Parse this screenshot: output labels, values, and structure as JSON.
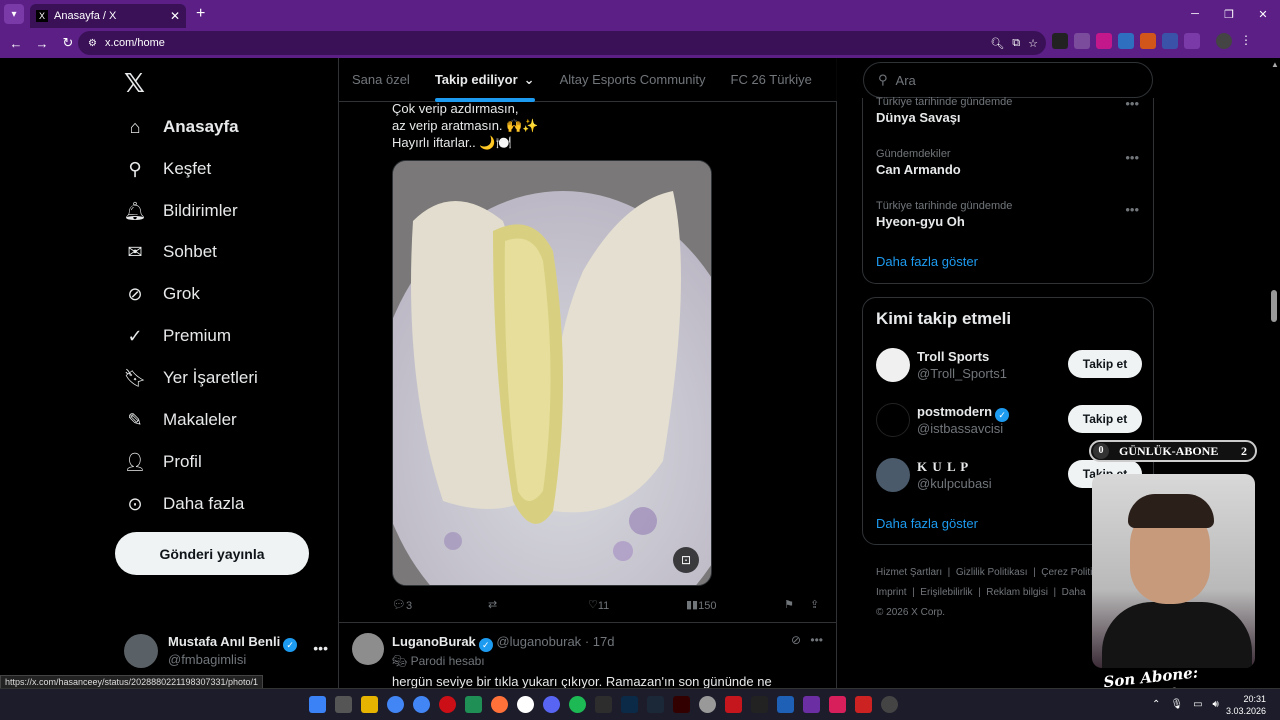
{
  "browser": {
    "tab_title": "Anasayfa / X",
    "url": "x.com/home",
    "status_link": "https://x.com/hasanceey/status/2028880221198307331/photo/1"
  },
  "sidebar": {
    "items": [
      {
        "label": "Anasayfa",
        "icon": "home-icon"
      },
      {
        "label": "Keşfet",
        "icon": "search-icon"
      },
      {
        "label": "Bildirimler",
        "icon": "bell-icon"
      },
      {
        "label": "Sohbet",
        "icon": "mail-icon"
      },
      {
        "label": "Grok",
        "icon": "grok-icon"
      },
      {
        "label": "Premium",
        "icon": "premium-icon"
      },
      {
        "label": "Yer İşaretleri",
        "icon": "bookmark-icon"
      },
      {
        "label": "Makaleler",
        "icon": "article-icon"
      },
      {
        "label": "Profil",
        "icon": "profile-icon"
      },
      {
        "label": "Daha fazla",
        "icon": "more-circle-icon"
      }
    ],
    "post_button": "Gönderi yayınla",
    "account": {
      "name": "Mustafa Anıl Benli",
      "handle": "@fmbagimlisi"
    }
  },
  "feed": {
    "tabs": [
      "Sana özel",
      "Takip ediliyor",
      "Altay Esports Community",
      "FC 26 Türkiye"
    ],
    "active_tab": "Takip ediliyor",
    "tweet": {
      "lines": [
        "Çok verip azdırmasın,",
        "az verip aratmasın. 🙌✨",
        "Hayırlı iftarlar.. 🌙🍽️"
      ],
      "replies": "3",
      "likes": "11",
      "views": "150"
    },
    "tweet2": {
      "name": "LuganoBurak",
      "handle": "@luganoburak",
      "time": "· 17d",
      "label": "Parodi hesabı",
      "body": "hergün seviye bir tıkla yukarı çıkıyor. Ramazan'ın son gününde ne"
    }
  },
  "right": {
    "search_placeholder": "Ara",
    "trends": [
      {
        "context": "Türkiye tarihinde gündemde",
        "title": "Dünya Savaşı"
      },
      {
        "context": "Gündemdekiler",
        "title": "Can Armando"
      },
      {
        "context": "Türkiye tarihinde gündemde",
        "title": "Hyeon-gyu Oh"
      }
    ],
    "show_more": "Daha fazla göster",
    "who_to_follow_title": "Kimi takip etmeli",
    "follow": [
      {
        "name": "Troll Sports",
        "handle": "@Troll_Sports1",
        "button": "Takip et"
      },
      {
        "name": "postmodern",
        "handle": "@istbassavcisi",
        "button": "Takip et"
      },
      {
        "name": "K U L P",
        "handle": "@kulpcubasi",
        "button": "Takip et"
      }
    ],
    "show_more2": "Daha fazla göster",
    "footer": [
      "Hizmet Şartları",
      "Gizlilik Politikası",
      "Çerez Politi",
      "Imprint",
      "Erişilebilirlik",
      "Reklam bilgisi",
      "Daha",
      "© 2026 X Corp."
    ]
  },
  "overlay": {
    "abone_left": "0",
    "abone_label": "GÜNLÜK-ABONE",
    "abone_right": "2",
    "signature": "Son Abone: cemgonte"
  },
  "tray": {
    "time": "20:31",
    "date": "3.03.2026"
  },
  "colors": {
    "accent": "#1d9bf0",
    "browser": "#5b1f86"
  }
}
